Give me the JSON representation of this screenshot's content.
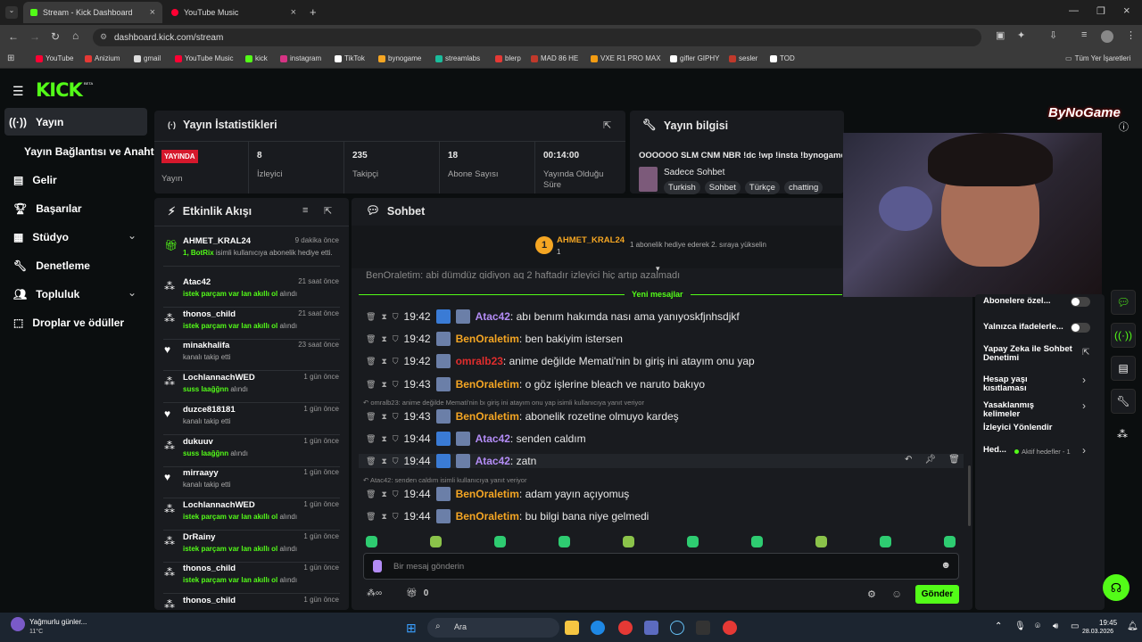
{
  "browser": {
    "tabs": [
      {
        "label": "Stream - Kick Dashboard"
      },
      {
        "label": "YouTube Music"
      }
    ],
    "url": "dashboard.kick.com/stream",
    "bookmarks": [
      "YouTube",
      "Anizium",
      "gmail",
      "YouTube Music",
      "kick",
      "instagram",
      "TikTok",
      "bynogame",
      "streamlabs",
      "blerp",
      "MAD 86 HE",
      "VXE R1 PRO MAX",
      "gifler GIPHY",
      "sesler",
      "TOD"
    ],
    "bookmarks_all": "Tüm Yer İşaretleri"
  },
  "app": {
    "logo": "KICK",
    "beta": "BETA",
    "overlay_text": "ByNoGame"
  },
  "nav": {
    "items": [
      "Yayın",
      "Yayın Bağlantısı ve Anahtarı",
      "Gelir",
      "Başarılar",
      "Stüdyo",
      "Denetleme",
      "Topluluk",
      "Droplar ve ödüller"
    ]
  },
  "stats": {
    "title": "Yayın İstatistikleri",
    "live_badge": "YAYINDA",
    "live_label": "Yayın",
    "cells": [
      {
        "value": "8",
        "label": "İzleyici"
      },
      {
        "value": "235",
        "label": "Takipçi"
      },
      {
        "value": "18",
        "label": "Abone Sayısı"
      },
      {
        "value": "00:14:00",
        "label": "Yayında Olduğu Süre"
      }
    ]
  },
  "info": {
    "title": "Yayın bilgisi",
    "stream_title": "OOOOOO SLM CNM NBR !dc !wp !insta !bynogame",
    "category": "Sadece Sohbet",
    "tags": [
      "Turkish",
      "Sohbet",
      "Türkçe",
      "chatting"
    ]
  },
  "activity": {
    "title": "Etkinlik Akışı",
    "items": [
      {
        "name": "AHMET_KRAL24",
        "time": "9 dakika önce",
        "desc_pre": "1, BotRix",
        "desc": " isimli kullanıcıya abonelik hediye etti."
      },
      {
        "name": "Atac42",
        "time": "21 saat önce",
        "desc_pre": "istek parçam var lan akıllı ol",
        "desc": " alındı"
      },
      {
        "name": "thonos_child",
        "time": "21 saat önce",
        "desc_pre": "istek parçam var lan akıllı ol",
        "desc": " alındı"
      },
      {
        "name": "minakhalifa",
        "time": "23 saat önce",
        "desc_pre": "",
        "desc": "kanalı takip etti"
      },
      {
        "name": "LochlannachWED",
        "time": "1 gün önce",
        "desc_pre": "suss laağğnn",
        "desc": " alındı"
      },
      {
        "name": "duzce818181",
        "time": "1 gün önce",
        "desc_pre": "",
        "desc": "kanalı takip etti"
      },
      {
        "name": "dukuuv",
        "time": "1 gün önce",
        "desc_pre": "suss laağğnn",
        "desc": " alındı"
      },
      {
        "name": "mirraayy",
        "time": "1 gün önce",
        "desc_pre": "",
        "desc": "kanalı takip etti"
      },
      {
        "name": "LochlannachWED",
        "time": "1 gün önce",
        "desc_pre": "istek parçam var lan akıllı ol",
        "desc": " alındı"
      },
      {
        "name": "DrRainy",
        "time": "1 gün önce",
        "desc_pre": "istek parçam var lan akıllı ol",
        "desc": " alındı"
      },
      {
        "name": "thonos_child",
        "time": "1 gün önce",
        "desc_pre": "istek parçam var lan akıllı ol",
        "desc": " alındı"
      },
      {
        "name": "thonos_child",
        "time": "1 gün önce",
        "desc_pre": "",
        "desc": ""
      }
    ]
  },
  "chat": {
    "title": "Sohbet",
    "pinned_user": "AHMET_KRAL24",
    "pinned_count": "1",
    "pinned_text": "1 abonelik hediye ederek 2. sıraya yükselin",
    "partial": "BenOraletim: abi dümdüz gidiyon aq 2 haftadır izleyici hiç artıp azalmadı",
    "new_messages": "Yeni mesajlar",
    "messages": [
      {
        "time": "19:42",
        "user": "Atac42",
        "text": ": abı benım hakımda nası ama yanıyoskfjnhsdjkf",
        "cls": "u1"
      },
      {
        "time": "19:42",
        "user": "BenOraletim",
        "text": ": ben bakiyim istersen",
        "cls": "u2"
      },
      {
        "time": "19:42",
        "user": "omralb23",
        "text": ": anime değilde Memati'nin bı giriş ini atayım onu yap",
        "cls": "u3"
      },
      {
        "time": "19:43",
        "user": "BenOraletim",
        "text": ": o göz işlerine bleach ve naruto bakıyo",
        "cls": "u2"
      },
      {
        "time": "19:43",
        "user": "BenOraletim",
        "text": ": abonelik rozetine olmuyo kardeş",
        "cls": "u2"
      },
      {
        "time": "19:44",
        "user": "Atac42",
        "text": ": senden caldım",
        "cls": "u1"
      },
      {
        "time": "19:44",
        "user": "Atac42",
        "text": ": zatn",
        "cls": "u1"
      },
      {
        "time": "19:44",
        "user": "BenOraletim",
        "text": ": adam yayın açıyomuş",
        "cls": "u2"
      },
      {
        "time": "19:44",
        "user": "BenOraletim",
        "text": ": bu bilgi bana niye gelmedi",
        "cls": "u2"
      }
    ],
    "reply1": "omralb23: anime değilde Memati'nin bı giriş ini atayım onu yap isimli kullanıcıya yanıt veriyor",
    "reply2": "Atac42: senden caldım isimli kullanıcıya yanıt veriyor",
    "input_placeholder": "Bir mesaj gönderin",
    "points": "0",
    "send": "Gönder"
  },
  "settings": {
    "items": [
      "Abonelere özel...",
      "Yalnızca ifadelerle...",
      "Yapay Zeka ile Sohbet Denetimi",
      "Hesap yaşı kısıtlaması",
      "Yasaklanmış kelimeler",
      "İzleyici Yönlendir",
      "Hed..."
    ],
    "goal": "Aktif hedefler - 1"
  },
  "taskbar": {
    "weather": "Yağmurlu günler...",
    "temp": "11°C",
    "search": "Ara",
    "time": "19:45",
    "date": "28.03.2026"
  }
}
